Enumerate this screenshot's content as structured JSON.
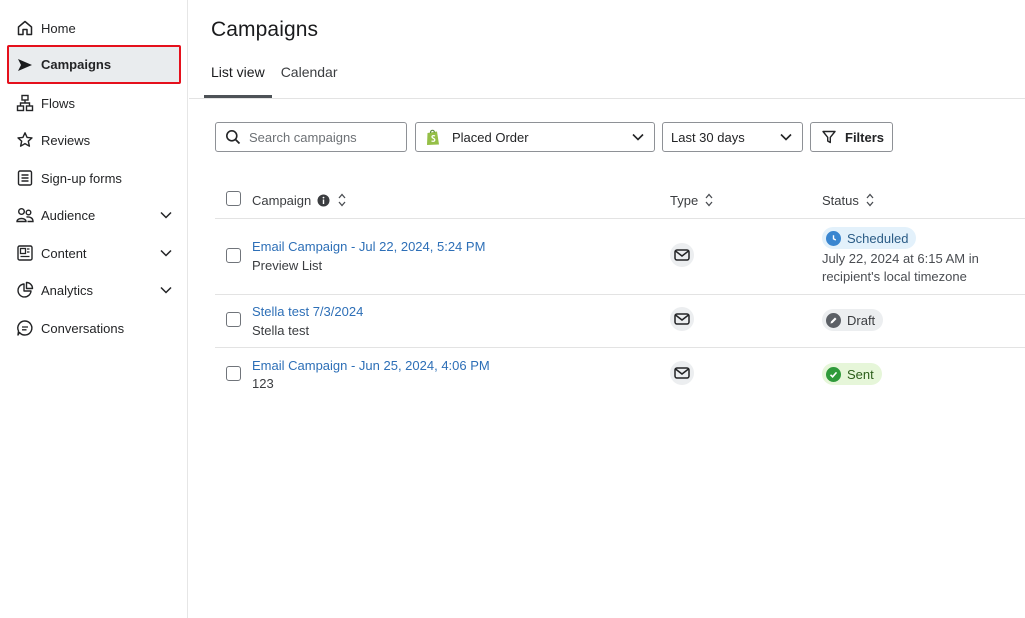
{
  "sidebar": {
    "items": [
      {
        "label": "Home",
        "icon": "home-icon"
      },
      {
        "label": "Campaigns",
        "icon": "send-icon"
      },
      {
        "label": "Flows",
        "icon": "flows-icon"
      },
      {
        "label": "Reviews",
        "icon": "star-icon"
      },
      {
        "label": "Sign-up forms",
        "icon": "form-icon"
      },
      {
        "label": "Audience",
        "icon": "audience-icon"
      },
      {
        "label": "Content",
        "icon": "content-icon"
      },
      {
        "label": "Analytics",
        "icon": "analytics-icon"
      },
      {
        "label": "Conversations",
        "icon": "chat-icon"
      }
    ]
  },
  "header": {
    "title": "Campaigns",
    "tabs": [
      {
        "label": "List view",
        "active": true
      },
      {
        "label": "Calendar",
        "active": false
      }
    ]
  },
  "toolbar": {
    "search_placeholder": "Search campaigns",
    "metric_value": "Placed Order",
    "date_value": "Last 30 days",
    "filters_label": "Filters"
  },
  "table": {
    "columns": {
      "campaign": "Campaign",
      "type": "Type",
      "status": "Status"
    },
    "rows": [
      {
        "name": "Email Campaign - Jul 22, 2024, 5:24 PM",
        "subtitle": "Preview List",
        "type": "email-icon",
        "status": "Scheduled",
        "status_detail": "July 22, 2024 at 6:15 AM in recipient's local timezone"
      },
      {
        "name": "Stella test 7/3/2024",
        "subtitle": "Stella test",
        "type": "email-icon",
        "status": "Draft"
      },
      {
        "name": "Email Campaign - Jun 25, 2024, 4:06 PM",
        "subtitle": "123",
        "type": "email-icon",
        "status": "Sent"
      }
    ]
  },
  "colors": {
    "link": "#2d6fb7",
    "active_highlight": "#e5101c",
    "scheduled": "#3a86d0",
    "sent": "#2f9a3a"
  }
}
